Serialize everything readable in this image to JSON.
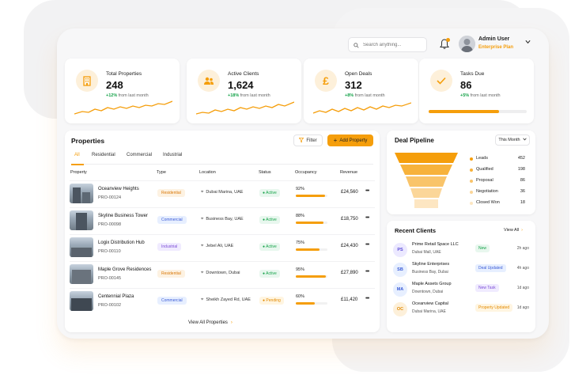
{
  "header": {
    "search_placeholder": "Search anything...",
    "user_name": "Admin User",
    "user_plan": "Enterprise Plan"
  },
  "stats": [
    {
      "title": "Total Properties",
      "value": "248",
      "change": "+12%",
      "change_text": "from last month",
      "icon": "building-icon"
    },
    {
      "title": "Active Clients",
      "value": "1,624",
      "change": "+18%",
      "change_text": "from last month",
      "icon": "users-icon"
    },
    {
      "title": "Open Deals",
      "value": "312",
      "change": "+8%",
      "change_text": "from last month",
      "icon": "pound-icon"
    },
    {
      "title": "Tasks Due",
      "value": "86",
      "change": "+5%",
      "change_text": "from last month",
      "icon": "check-icon",
      "progress": 0.72
    }
  ],
  "properties": {
    "title": "Properties",
    "filter_label": "Filter",
    "add_label": "Add Property",
    "tabs": [
      "All",
      "Residential",
      "Commercial",
      "Industrial"
    ],
    "active_tab": "All",
    "columns": [
      "Property",
      "Type",
      "Location",
      "Status",
      "Occupancy",
      "Revenue"
    ],
    "rows": [
      {
        "name": "Oceanview Heights",
        "id": "PRO-00124",
        "type": "Residential",
        "location": "Dubai Marina, UAE",
        "status": "Active",
        "occupancy": "92%",
        "occ_frac": 0.92,
        "revenue": "£24,560"
      },
      {
        "name": "Skyline Business Tower",
        "id": "PRO-00098",
        "type": "Commercial",
        "location": "Business Bay, UAE",
        "status": "Active",
        "occupancy": "88%",
        "occ_frac": 0.88,
        "revenue": "£18,750"
      },
      {
        "name": "Logix Distribution Hub",
        "id": "PRO-00110",
        "type": "Industrial",
        "location": "Jebel Ali, UAE",
        "status": "Active",
        "occupancy": "75%",
        "occ_frac": 0.75,
        "revenue": "£24,430"
      },
      {
        "name": "Maple Grove Residences",
        "id": "PRO-00145",
        "type": "Residential",
        "location": "Downtown, Dubai",
        "status": "Active",
        "occupancy": "95%",
        "occ_frac": 0.95,
        "revenue": "£27,890"
      },
      {
        "name": "Centennial Plaza",
        "id": "PRO-00102",
        "type": "Commercial",
        "location": "Sheikh Zayed Rd, UAE",
        "status": "Pending",
        "occupancy": "60%",
        "occ_frac": 0.6,
        "revenue": "£11,420"
      }
    ],
    "view_all": "View All Properties"
  },
  "pipeline": {
    "title": "Deal Pipeline",
    "period": "This Month",
    "stages": [
      {
        "name": "Leads",
        "value": "452",
        "color": "#f59e0b"
      },
      {
        "name": "Qualified",
        "value": "198",
        "color": "#f7b23b"
      },
      {
        "name": "Proposal",
        "value": "86",
        "color": "#f9c46a"
      },
      {
        "name": "Negotiation",
        "value": "36",
        "color": "#fbd699"
      },
      {
        "name": "Closed Won",
        "value": "18",
        "color": "#fde6c2"
      }
    ]
  },
  "clients": {
    "title": "Recent Clients",
    "view_all": "View All",
    "items": [
      {
        "initials": "PS",
        "name": "Prime Retail Space LLC",
        "location": "Dubai Mall, UAE",
        "tag": "New",
        "ago": "2h ago",
        "tag_bg": "#e8f7ee",
        "tag_fg": "#16a34a",
        "av_bg": "#ece9ff",
        "av_fg": "#5b4bd6"
      },
      {
        "initials": "SB",
        "name": "Skyline Enterprises",
        "location": "Business Bay, Dubai",
        "tag": "Deal Updated",
        "ago": "4h ago",
        "tag_bg": "#e7efff",
        "tag_fg": "#3b5bd6",
        "av_bg": "#e7efff",
        "av_fg": "#3b5bd6"
      },
      {
        "initials": "MA",
        "name": "Maple Assets Group",
        "location": "Downtown, Dubai",
        "tag": "New Task",
        "ago": "1d ago",
        "tag_bg": "#f0ebff",
        "tag_fg": "#7c4dd6",
        "av_bg": "#e7efff",
        "av_fg": "#3b5bd6"
      },
      {
        "initials": "OC",
        "name": "Oceanview Capital",
        "location": "Dubai Marina, UAE",
        "tag": "Property Updated",
        "ago": "1d ago",
        "tag_bg": "#fff5e1",
        "tag_fg": "#e38a00",
        "av_bg": "#fdf0da",
        "av_fg": "#e38a00"
      }
    ]
  },
  "colors": {
    "accent": "#f59e0b",
    "positive": "#16a34a"
  }
}
